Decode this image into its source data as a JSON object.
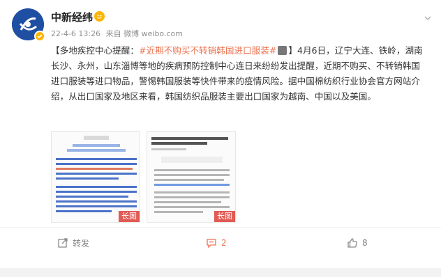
{
  "post": {
    "author": "中新经纬",
    "meta_date": "22-4-6 13:26",
    "meta_from": "来自 微博 weibo.com",
    "text_open": "【多地疾控中心提醒：",
    "hashtag": "#近期不购买不转销韩国进口服装#",
    "text_body": "】4月6日，辽宁大连、铁岭，湖南长沙、永州，山东淄博等地的疾病预防控制中心连日来纷纷发出提醒，近期不购买、不转销韩国进口服装等进口物品，警惕韩国服装等快件带来的疫情风险。据中国棉纺织行业协会官方网站介绍，从出口国家及地区来看，韩国纺织品服装主要出口国家为越南、中国以及美国。",
    "images": [
      {
        "label": "长图",
        "header": "大连发布"
      },
      {
        "label": "长图",
        "title": "长沙疾控提醒：警惕因购买疫情高发国商品带来的疫情风险"
      }
    ]
  },
  "actions": {
    "forward_label": "转发",
    "comment_count": "2",
    "like_count": "8"
  },
  "icons": {
    "forward": "share-icon",
    "comment": "comment-icon",
    "like": "thumbs-up-icon",
    "chevron": "chevron-down-icon"
  },
  "colors": {
    "accent": "#eb7350",
    "long_image_tag": "#e15a54",
    "avatar_bg": "#1f4fa3"
  }
}
